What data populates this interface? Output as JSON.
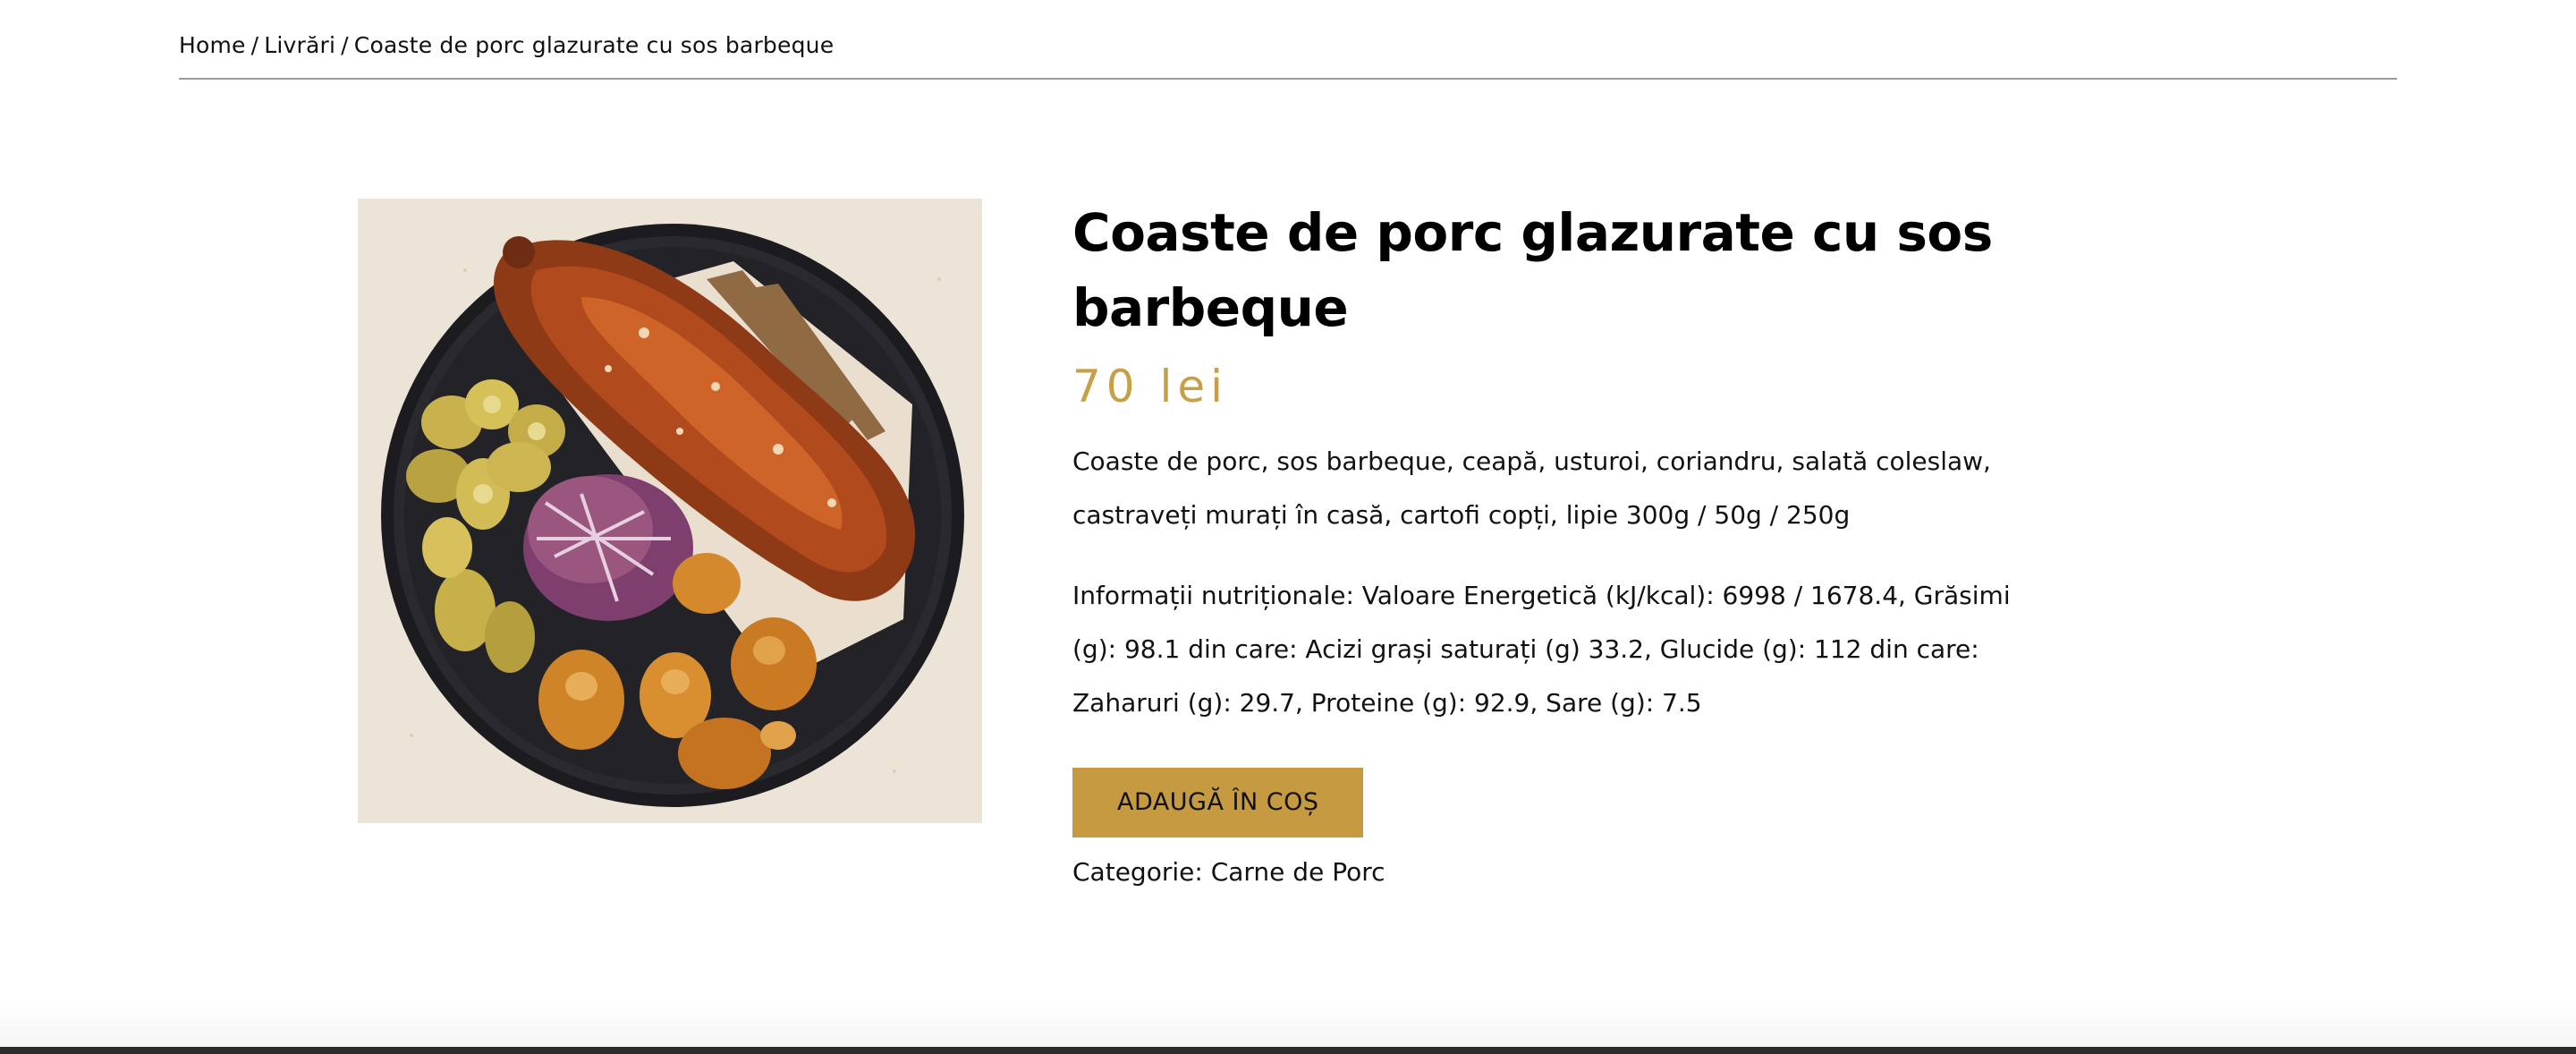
{
  "breadcrumb": {
    "home": "Home",
    "separator": "/",
    "category": "Livrări",
    "current": "Coaste de porc glazurate cu sos barbeque"
  },
  "product": {
    "title": "Coaste de porc glazurate cu sos barbeque",
    "price": "70 lei",
    "description": "Coaste de porc, sos barbeque, ceapă, usturoi, coriandru, salată coleslaw, castraveți murați în casă, cartofi copți, lipie 300g / 50g / 250g",
    "nutrition": "Informații nutriționale: Valoare Energetică (kJ/kcal): 6998 / 1678.4, Grăsimi (g): 98.1 din care: Acizi grași saturați (g) 33.2, Glucide (g): 112 din care: Zaharuri (g): 29.7, Proteine (g): 92.9, Sare (g): 7.5",
    "add_to_cart_label": "ADAUGĂ ÎN COȘ",
    "category_label": "Categorie:",
    "category_value": "Carne de Porc"
  },
  "colors": {
    "accent": "#c69a40",
    "price": "#c6a047",
    "rule": "#9c9c9c",
    "footer": "#2b2b2b"
  }
}
